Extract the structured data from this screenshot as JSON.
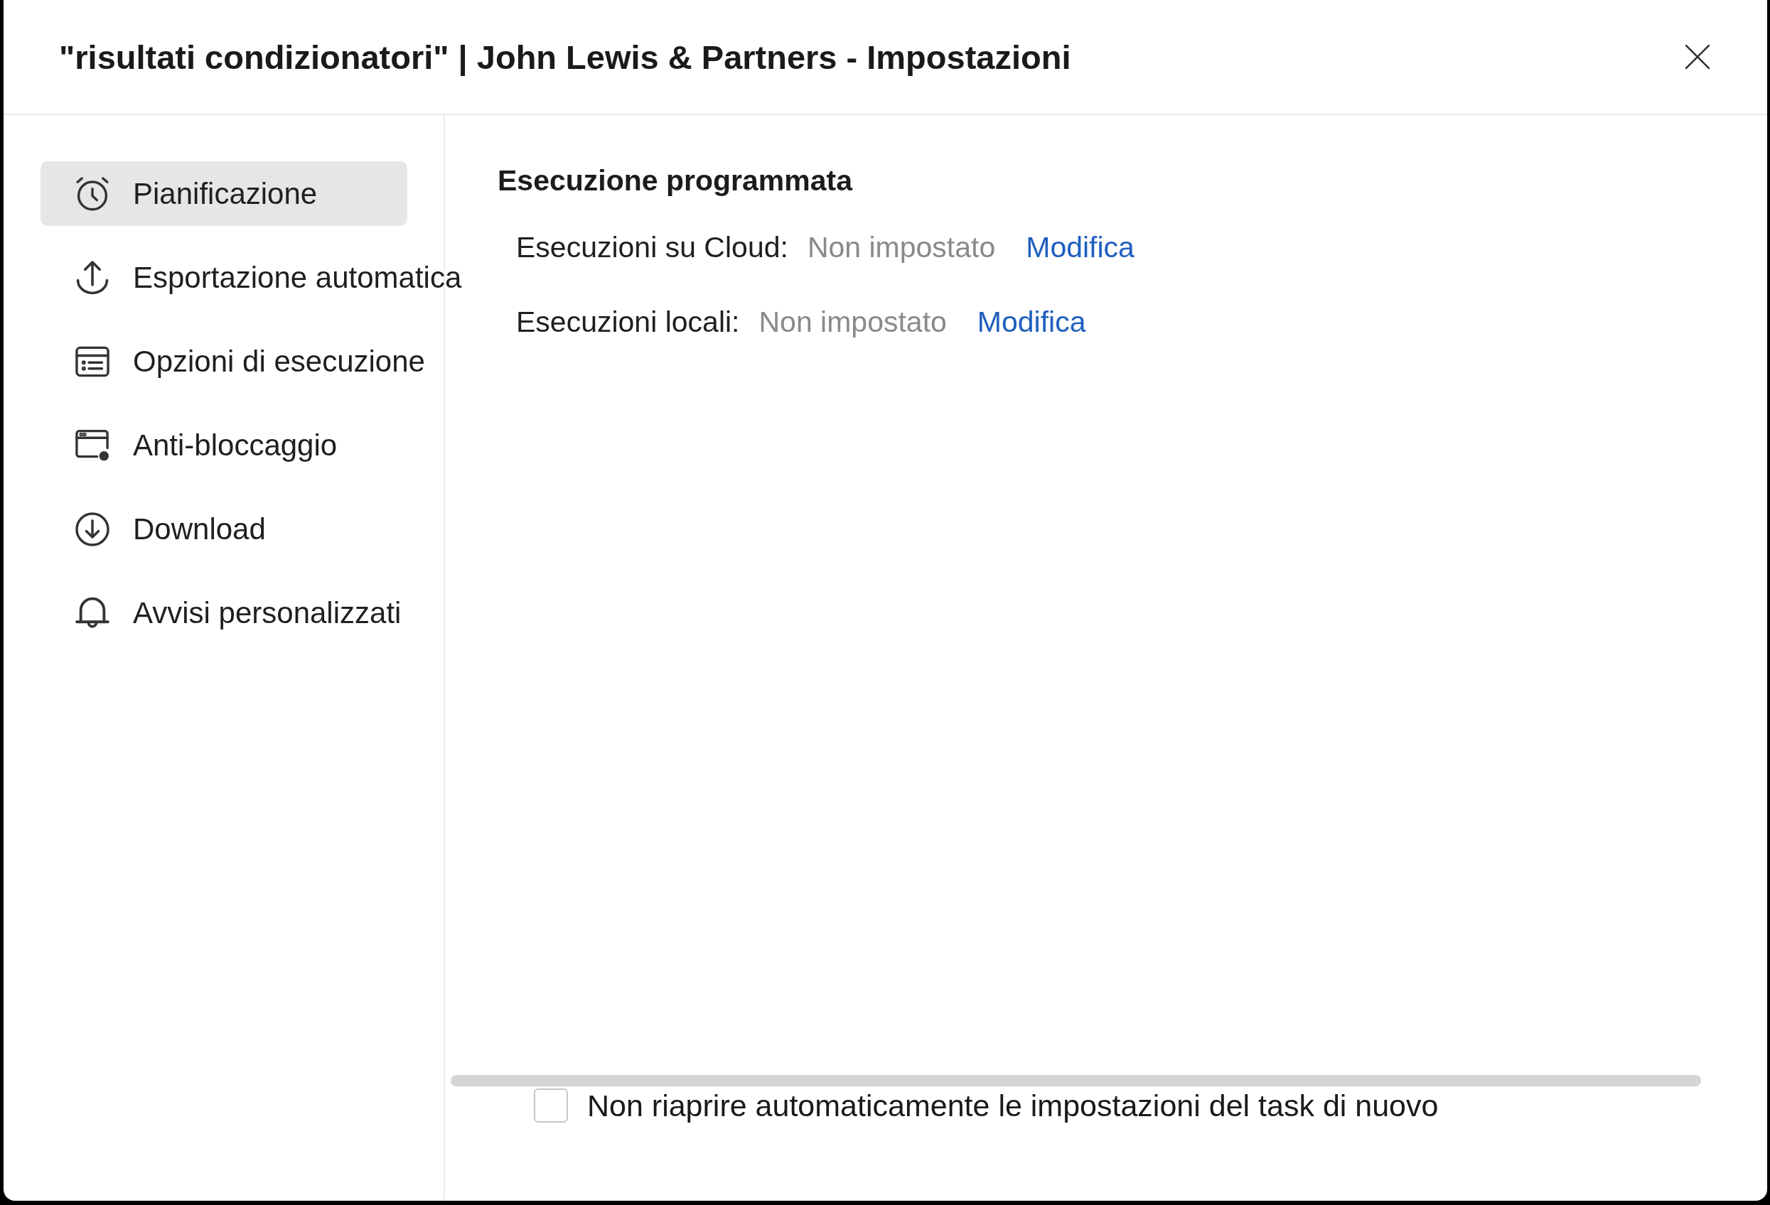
{
  "window": {
    "title": "\"risultati condizionatori\" | John Lewis & Partners - Impostazioni"
  },
  "sidebar": {
    "items": [
      {
        "label": "Pianificazione",
        "selected": true
      },
      {
        "label": "Esportazione automatica",
        "selected": false
      },
      {
        "label": "Opzioni di esecuzione",
        "selected": false
      },
      {
        "label": "Anti-bloccaggio",
        "selected": false
      },
      {
        "label": "Download",
        "selected": false
      },
      {
        "label": "Avvisi personalizzati",
        "selected": false
      }
    ]
  },
  "panel": {
    "heading": "Esecuzione programmata",
    "rows": [
      {
        "label": "Esecuzioni su Cloud:",
        "value": "Non impostato",
        "link": "Modifica"
      },
      {
        "label": "Esecuzioni locali:",
        "value": "Non impostato",
        "link": "Modifica"
      }
    ]
  },
  "footer": {
    "checkbox": {
      "label": "Non riaprire automaticamente le impostazioni del task di nuovo",
      "checked": false
    }
  }
}
